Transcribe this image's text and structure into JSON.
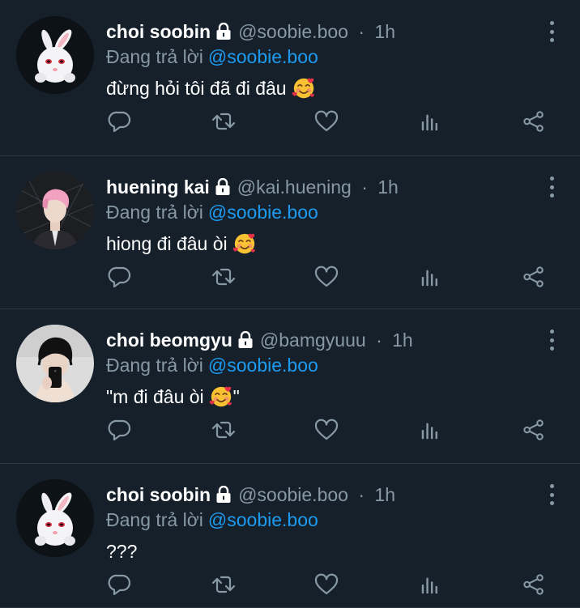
{
  "replying_label": "Đang trả lời",
  "separator": "·",
  "colors": {
    "background": "#15202b",
    "muted": "#8899a6",
    "mention": "#1d9bf0",
    "divider": "#2a3641"
  },
  "icons": {
    "lock": "lock-icon",
    "reply": "reply-icon",
    "retweet": "retweet-icon",
    "like": "heart-icon",
    "analytics": "analytics-icon",
    "share": "share-icon",
    "more": "more-options-icon",
    "emoji": "smiling-face-with-hearts-emoji"
  },
  "tweets": [
    {
      "name": "choi soobin",
      "handle": "@soobie.boo",
      "time": "1h",
      "replying_to": "@soobie.boo",
      "text": "đừng hỏi tôi đã đi đâu",
      "text_after": "",
      "has_emoji": true,
      "avatar": "white rabbit"
    },
    {
      "name": "huening kai",
      "handle": "@kai.huening",
      "time": "1h",
      "replying_to": "@soobie.boo",
      "text": "hiong đi đâu òi",
      "text_after": "",
      "has_emoji": true,
      "avatar": "pink-haired person"
    },
    {
      "name": "choi beomgyu",
      "handle": "@bamgyuuu",
      "time": "1h",
      "replying_to": "@soobie.boo",
      "text": "\"m đi đâu òi",
      "text_after": "\"",
      "has_emoji": true,
      "avatar": "person taking mirror selfie"
    },
    {
      "name": "choi soobin",
      "handle": "@soobie.boo",
      "time": "1h",
      "replying_to": "@soobie.boo",
      "text": "???",
      "text_after": "",
      "has_emoji": false,
      "avatar": "white rabbit"
    }
  ]
}
